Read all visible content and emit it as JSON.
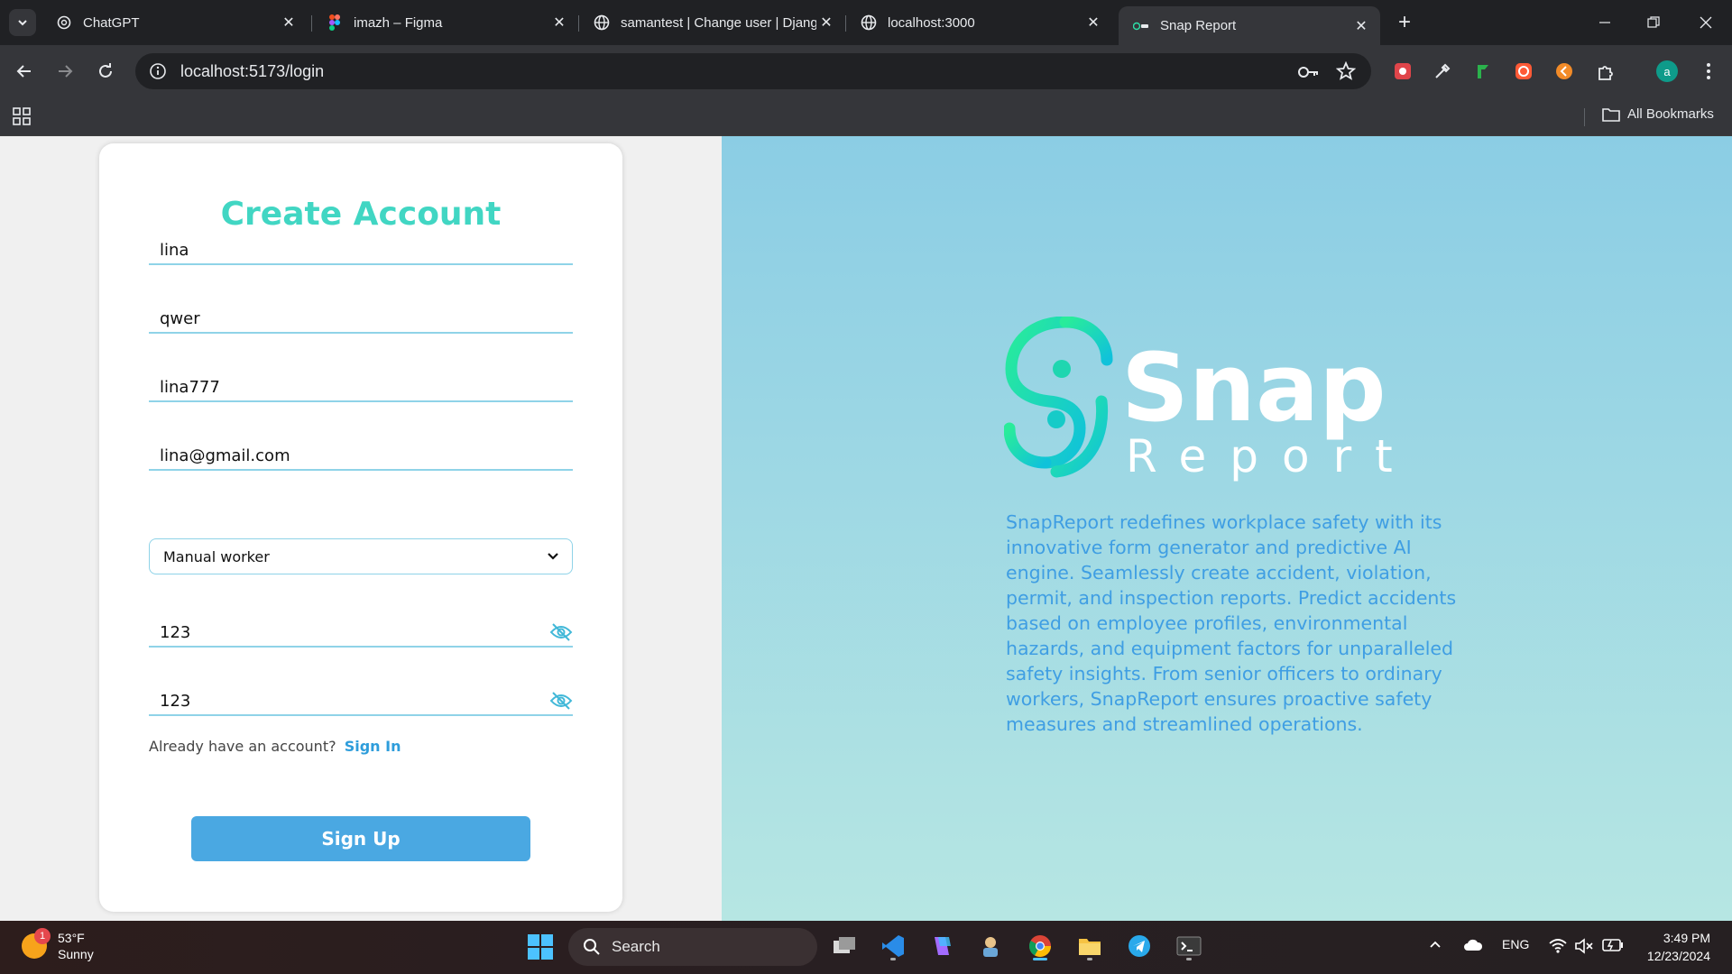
{
  "browser": {
    "tabs": [
      {
        "title": "ChatGPT",
        "icon": "chatgpt-icon"
      },
      {
        "title": "imazh – Figma",
        "icon": "figma-icon"
      },
      {
        "title": "samantest | Change user | Djang",
        "icon": "globe-icon"
      },
      {
        "title": "localhost:3000",
        "icon": "globe-icon"
      },
      {
        "title": "Snap Report",
        "icon": "snap-report-icon"
      }
    ],
    "active_tab_index": 4,
    "url": "localhost:5173/login",
    "bookmarks_label": "All Bookmarks",
    "profile_initial": "a"
  },
  "form": {
    "title": "Create Account",
    "fields": {
      "first_name": "lina",
      "last_name": "qwer",
      "username": "lina777",
      "email": "lina@gmail.com",
      "role": "Manual worker",
      "password": "123",
      "confirm_password": "123"
    },
    "signin_prompt": "Already have an account?",
    "signin_link": "Sign In",
    "submit_label": "Sign Up"
  },
  "brand": {
    "name_top": "Snap",
    "name_bottom": "Report",
    "description": "SnapReport redefines workplace safety with its innovative form generator and predictive AI engine. Seamlessly create accident, violation, permit, and inspection reports. Predict accidents based on employee profiles, environmental hazards, and equipment factors for unparalleled safety insights. From senior officers to ordinary workers, SnapReport ensures proactive safety measures and streamlined operations.",
    "colors": {
      "title": "#41d6c3",
      "accent": "#4aa8e2",
      "desc": "#3f9ee3"
    }
  },
  "taskbar": {
    "weather_temp": "53°F",
    "weather_desc": "Sunny",
    "weather_badge": "1",
    "search_label": "Search",
    "language": "ENG",
    "time": "3:49 PM",
    "date": "12/23/2024"
  }
}
